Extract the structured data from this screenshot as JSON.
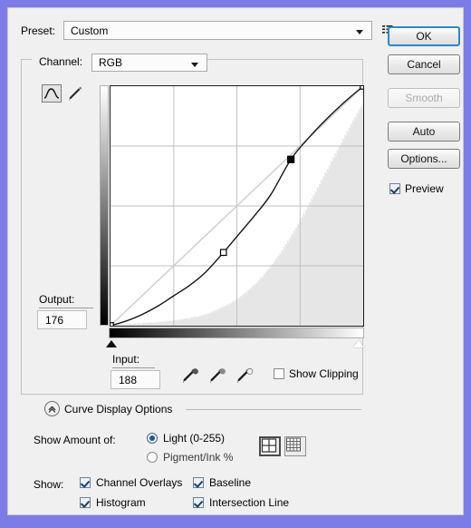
{
  "dialog": {
    "preset": {
      "label": "Preset:",
      "value": "Custom",
      "menu_icon": "preset-menu-icon"
    },
    "channel": {
      "label": "Channel:",
      "value": "RGB"
    },
    "tools": {
      "curve_icon": "curve-tool-icon",
      "pencil_icon": "pencil-tool-icon"
    },
    "output": {
      "label": "Output:",
      "value": "176"
    },
    "input": {
      "label": "Input:",
      "value": "188"
    },
    "eyedroppers": [
      {
        "name": "set-black-point-eyedropper-icon"
      },
      {
        "name": "set-gray-point-eyedropper-icon"
      },
      {
        "name": "set-white-point-eyedropper-icon"
      }
    ],
    "show_clipping": {
      "label": "Show Clipping",
      "checked": false
    },
    "curve_display_options": {
      "title": "Curve Display Options",
      "expanded": true,
      "show_amount_label": "Show Amount of:",
      "amount_options": [
        {
          "label": "Light  (0-255)",
          "selected": true
        },
        {
          "label": "Pigment/Ink %",
          "selected": false
        }
      ],
      "grid_buttons": [
        {
          "name": "grid-simple-icon",
          "selected": true
        },
        {
          "name": "grid-detailed-icon",
          "selected": false
        }
      ],
      "show_label": "Show:",
      "show_options": [
        {
          "label": "Channel Overlays",
          "checked": true
        },
        {
          "label": "Baseline",
          "checked": true
        },
        {
          "label": "Histogram",
          "checked": true
        },
        {
          "label": "Intersection Line",
          "checked": true
        }
      ]
    },
    "buttons": [
      {
        "label": "OK",
        "state": "default"
      },
      {
        "label": "Cancel",
        "state": "normal"
      },
      {
        "label": "Smooth",
        "state": "disabled"
      },
      {
        "label": "Auto",
        "state": "normal"
      },
      {
        "label": "Options...",
        "state": "normal"
      }
    ],
    "preview": {
      "label": "Preview",
      "checked": true
    }
  },
  "chart_data": {
    "type": "line",
    "title": "Tone Curve (RGB)",
    "xlabel": "Input",
    "ylabel": "Output",
    "xlim": [
      0,
      255
    ],
    "ylim": [
      0,
      255
    ],
    "grid": true,
    "grid_divisions": 4,
    "series": [
      {
        "name": "Baseline (identity)",
        "style": "diagonal-gray",
        "x": [
          0,
          255
        ],
        "y": [
          0,
          255
        ]
      },
      {
        "name": "Curve",
        "style": "black-spline",
        "control_points": [
          {
            "x": 0,
            "y": 0,
            "selected": false,
            "shape": "hollow-square"
          },
          {
            "x": 114,
            "y": 78,
            "selected": false,
            "shape": "hollow-square"
          },
          {
            "x": 182,
            "y": 177,
            "selected": true,
            "shape": "filled-square"
          },
          {
            "x": 255,
            "y": 255,
            "selected": false,
            "shape": "hollow-square"
          }
        ],
        "sampled_x": [
          0,
          16,
          32,
          48,
          64,
          80,
          96,
          114,
          130,
          146,
          162,
          182,
          200,
          218,
          236,
          255
        ],
        "sampled_y": [
          0,
          5,
          12,
          21,
          32,
          43,
          57,
          78,
          98,
          118,
          140,
          177,
          200,
          220,
          238,
          255
        ]
      },
      {
        "name": "Histogram",
        "style": "light-gray-fill",
        "bins": [
          2,
          1,
          1,
          2,
          1,
          1,
          2,
          1,
          2,
          1,
          1,
          2,
          1,
          1,
          2,
          1,
          3,
          2,
          2,
          3,
          2,
          2,
          3,
          2,
          3,
          2,
          2,
          3,
          2,
          3,
          2,
          3,
          3,
          4,
          3,
          3,
          4,
          3,
          4,
          3,
          4,
          4,
          3,
          4,
          3,
          4,
          4,
          5,
          4,
          5,
          4,
          5,
          5,
          4,
          5,
          6,
          5,
          6,
          5,
          6,
          6,
          5,
          6,
          7,
          6,
          7,
          7,
          6,
          7,
          8,
          7,
          8,
          7,
          8,
          8,
          9,
          8,
          9,
          9,
          8,
          9,
          10,
          9,
          10,
          11,
          10,
          11,
          10,
          11,
          12,
          11,
          12,
          13,
          12,
          13,
          14,
          13,
          14,
          15,
          14,
          16,
          15,
          17,
          16,
          18,
          17,
          19,
          18,
          20,
          19,
          21,
          22,
          20,
          23,
          22,
          24,
          23,
          25,
          26,
          24,
          27,
          26,
          28,
          30,
          28,
          31,
          30,
          33,
          32,
          34,
          33,
          36,
          35,
          38,
          36,
          40,
          38,
          42,
          40,
          44,
          43,
          46,
          45,
          48,
          47,
          50,
          49,
          52,
          51,
          55,
          54,
          58,
          56,
          60,
          59,
          63,
          62,
          66,
          65,
          69,
          68,
          72,
          71,
          75,
          74,
          78,
          77,
          82,
          80,
          85,
          84,
          88,
          87,
          92,
          90,
          96,
          94,
          99,
          98,
          103,
          101,
          107,
          105,
          111,
          110,
          115,
          113,
          119,
          118,
          123,
          122,
          128,
          126,
          131,
          130,
          136,
          134,
          140,
          139,
          145,
          143,
          150,
          148,
          154,
          153,
          159,
          157,
          163,
          162,
          168,
          166,
          172,
          171,
          177,
          175,
          181,
          180,
          186,
          184,
          190,
          189,
          195,
          193,
          200,
          198,
          204,
          203,
          209,
          207,
          213,
          212,
          218,
          216,
          222,
          221,
          227,
          225,
          231,
          230,
          236,
          234,
          240,
          239,
          245,
          243,
          249,
          248,
          253,
          252,
          258,
          256,
          262,
          261,
          266,
          265,
          270
        ]
      }
    ]
  }
}
